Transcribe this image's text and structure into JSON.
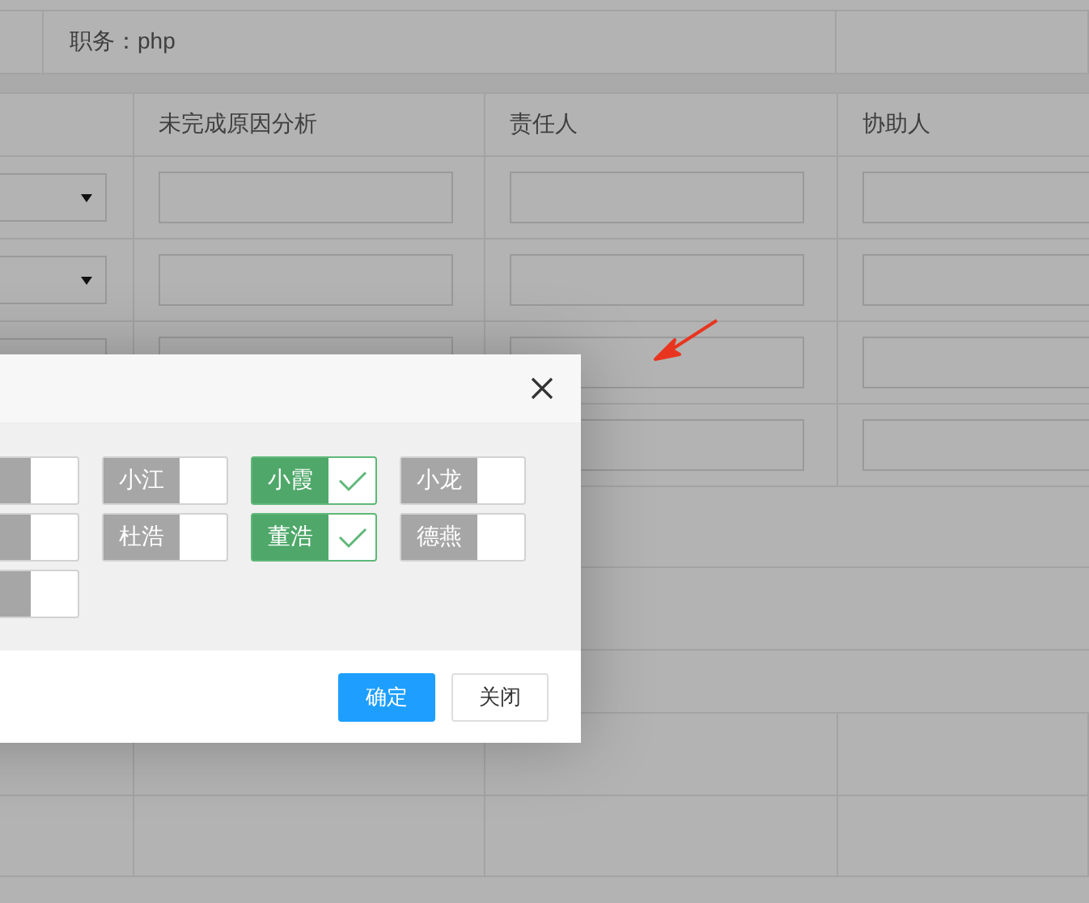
{
  "info_row": {
    "position_label": "职务：php"
  },
  "table": {
    "columns": [
      "未完成原因分析",
      "责任人",
      "协助人"
    ],
    "rows": [
      {
        "kind": "select"
      },
      {
        "kind": "select"
      },
      {
        "kind": "input"
      },
      {
        "kind": "input"
      }
    ]
  },
  "dialog": {
    "checkboxes": [
      {
        "checked": false
      },
      {
        "label": "小江",
        "checked": false
      },
      {
        "label": "小霞",
        "checked": true
      },
      {
        "label": "小龙",
        "checked": false
      },
      {
        "checked": false
      },
      {
        "label": "杜浩",
        "checked": false
      },
      {
        "label": "董浩",
        "checked": true
      },
      {
        "label": "德燕",
        "checked": false
      },
      {
        "checked": false
      }
    ],
    "buttons": [
      {
        "label": "确定",
        "kind": "primary"
      },
      {
        "label": "关闭",
        "kind": "secondary"
      }
    ]
  }
}
